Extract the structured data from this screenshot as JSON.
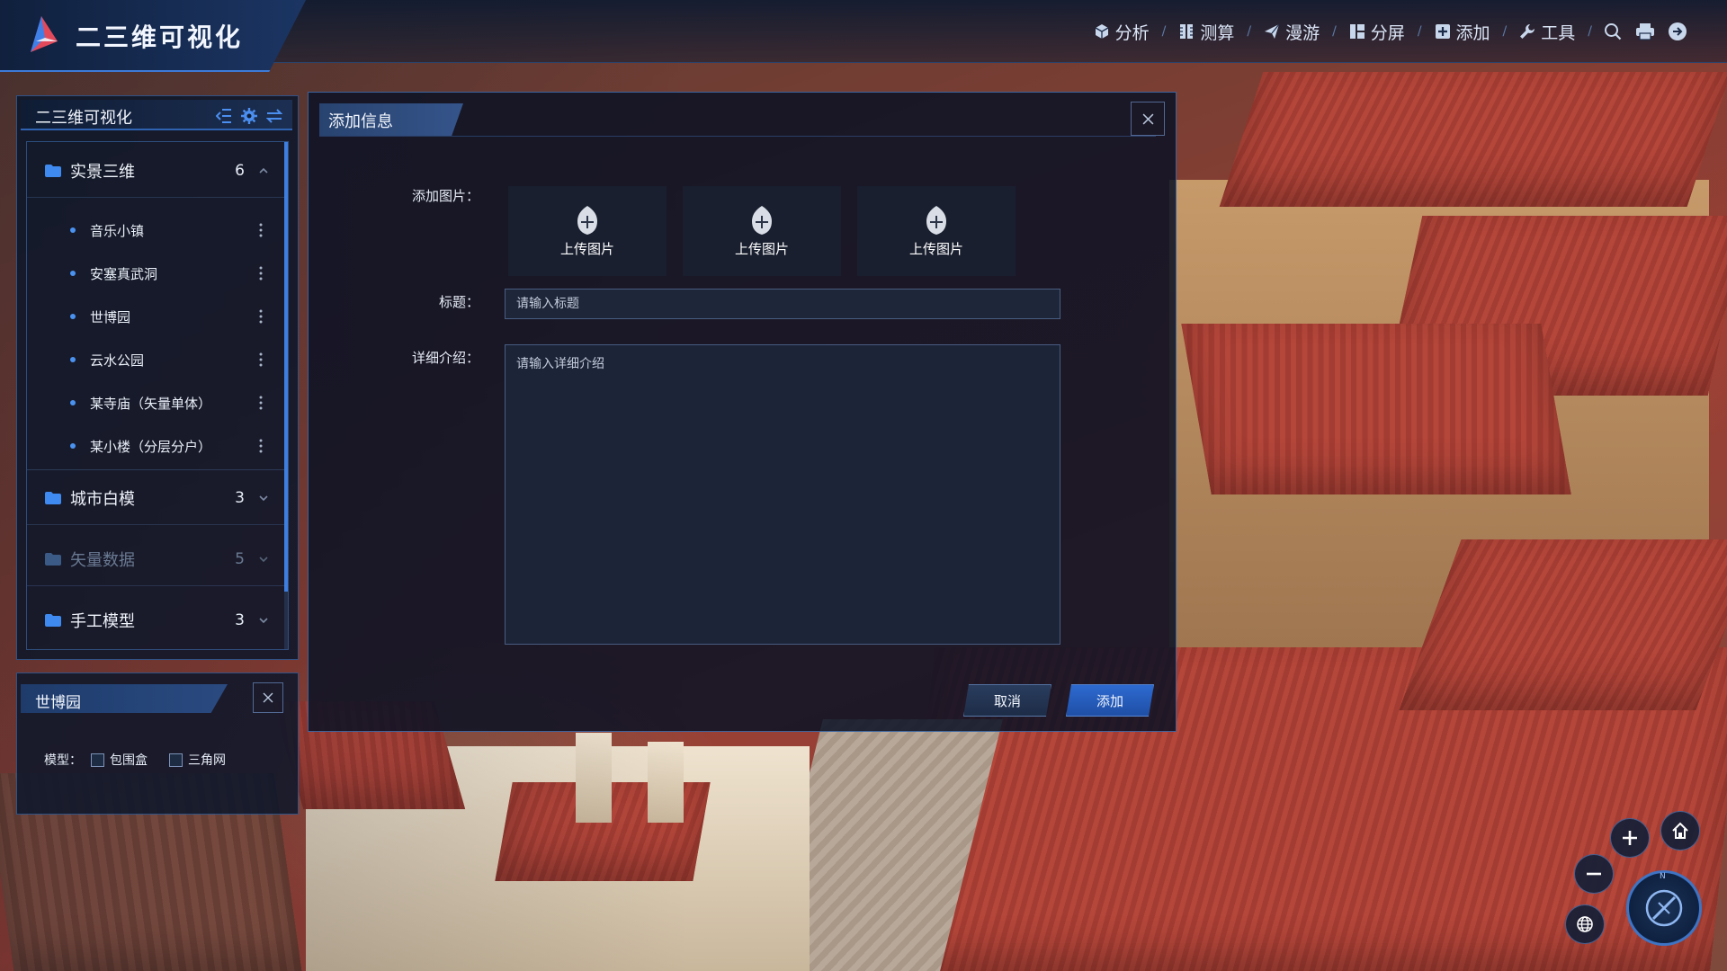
{
  "header": {
    "app_title": "二三维可视化",
    "nav": [
      {
        "label": "分析",
        "icon": "cube-icon"
      },
      {
        "label": "测算",
        "icon": "ruler-icon"
      },
      {
        "label": "漫游",
        "icon": "paper-plane-icon"
      },
      {
        "label": "分屏",
        "icon": "split-screen-icon"
      },
      {
        "label": "添加",
        "icon": "plus-square-icon"
      },
      {
        "label": "工具",
        "icon": "wrench-icon"
      }
    ],
    "icon_buttons": [
      "search-icon",
      "print-icon",
      "arrow-circle-icon"
    ]
  },
  "layer_panel": {
    "title": "二三维可视化",
    "tools": [
      "collapse-icon",
      "gear-icon",
      "swap-icon"
    ],
    "groups": [
      {
        "label": "实景三维",
        "count": "6",
        "expanded": true,
        "items": [
          "音乐小镇",
          "安塞真武洞",
          "世博园",
          "云水公园",
          "某寺庙（矢量单体）",
          "某小楼（分层分户）"
        ]
      },
      {
        "label": "城市白模",
        "count": "3",
        "expanded": false
      },
      {
        "label": "矢量数据",
        "count": "5",
        "expanded": false,
        "dimmed": true
      },
      {
        "label": "手工模型",
        "count": "3",
        "expanded": false
      }
    ]
  },
  "prop_panel": {
    "title": "世博园",
    "model_label": "模型：",
    "options": [
      "包围盒",
      "三角网"
    ]
  },
  "modal": {
    "title": "添加信息",
    "image_label": "添加图片：",
    "upload_label": "上传图片",
    "upload_slots": 3,
    "title_label": "标题：",
    "title_placeholder": "请输入标题",
    "detail_label": "详细介绍：",
    "detail_placeholder": "请输入详细介绍",
    "cancel_label": "取消",
    "add_label": "添加"
  },
  "map_controls": {
    "compass_label": "N"
  },
  "colors": {
    "accent": "#3d7fe0",
    "panel_bg": "#0c162a",
    "roof_red": "#b4463a"
  }
}
